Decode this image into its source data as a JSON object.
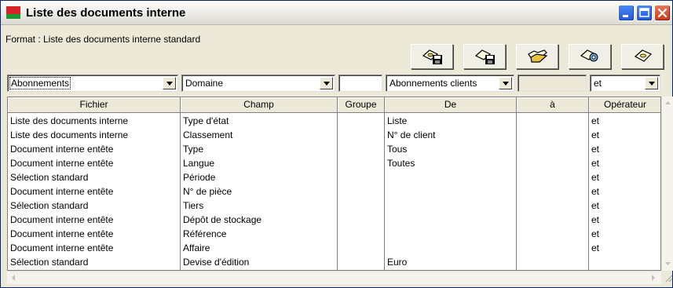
{
  "window": {
    "title": "Liste des documents interne"
  },
  "format": {
    "label": "Format : Liste des documents interne standard"
  },
  "toolbar": {
    "buttons": [
      {
        "icon": "save-disk-icon"
      },
      {
        "icon": "save-as-disk-icon"
      },
      {
        "icon": "open-folder-icon"
      },
      {
        "icon": "link-settings-icon"
      },
      {
        "icon": "clear-document-icon"
      }
    ]
  },
  "filters": {
    "table": "Abonnements",
    "field": "Domaine",
    "group": "",
    "from": "Abonnements clients",
    "to": "",
    "operator": "et"
  },
  "grid": {
    "columns": [
      "Fichier",
      "Champ",
      "Groupe",
      "De",
      "à",
      "Opérateur"
    ],
    "rows": [
      [
        "Liste des documents interne",
        "Type d'état",
        "",
        "Liste",
        "",
        "et"
      ],
      [
        "Liste des documents interne",
        "Classement",
        "",
        "N° de client",
        "",
        "et"
      ],
      [
        "Document interne entête",
        "Type",
        "",
        "Tous",
        "",
        "et"
      ],
      [
        "Document interne entête",
        "Langue",
        "",
        "Toutes",
        "",
        "et"
      ],
      [
        "Sélection standard",
        "Période",
        "",
        "",
        "",
        "et"
      ],
      [
        "Document interne entête",
        "N° de pièce",
        "",
        "",
        "",
        "et"
      ],
      [
        "Sélection standard",
        "Tiers",
        "",
        "",
        "",
        "et"
      ],
      [
        "Document interne entête",
        "Dépôt de stockage",
        "",
        "",
        "",
        "et"
      ],
      [
        "Document interne entête",
        "Référence",
        "",
        "",
        "",
        "et"
      ],
      [
        "Document interne entête",
        "Affaire",
        "",
        "",
        "",
        "et"
      ],
      [
        "Sélection standard",
        "Devise d'édition",
        "",
        "Euro",
        "",
        ""
      ]
    ]
  },
  "colors": {
    "titlebar": "#ece9d8",
    "window_bg": "#ece9d8",
    "grid_bg": "#ffffff",
    "close_button": "#c93a17",
    "window_button": "#2458d8"
  }
}
